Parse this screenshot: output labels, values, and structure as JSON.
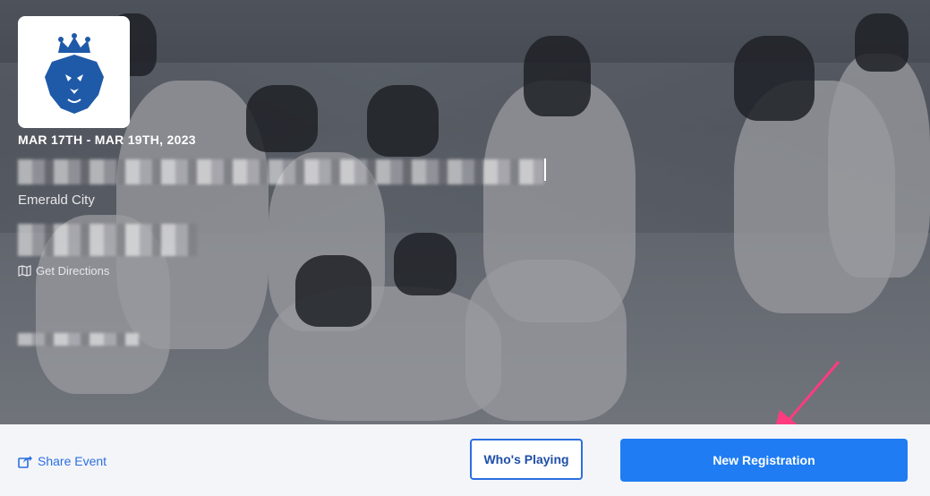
{
  "event": {
    "dates": "MAR 17TH - MAR 19TH, 2023",
    "city": "Emerald City",
    "directions_label": "Get Directions"
  },
  "footer": {
    "share_label": "Share Event",
    "whos_playing_label": "Who's Playing",
    "register_label": "New Registration"
  },
  "colors": {
    "primary": "#1f7cf2",
    "link": "#2b6fe0",
    "logo_blue": "#1e5aa8",
    "annotation_arrow": "#ff3b7f"
  },
  "icons": [
    "crown-lion-logo",
    "map-icon",
    "share-icon",
    "annotation-arrow"
  ]
}
